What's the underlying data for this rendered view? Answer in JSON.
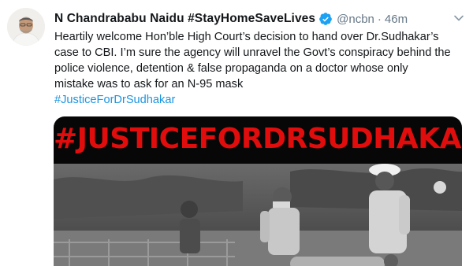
{
  "tweet": {
    "author_name": "N Chandrababu Naidu #StayHomeSaveLives",
    "handle": "@ncbn",
    "separator": "·",
    "timestamp": "46m",
    "text_lines": [
      "Heartily welcome Hon’ble High Court’s decision to hand over Dr.Sudhakar’s",
      "case to CBI. I’m sure the agency will unravel the Govt’s conspiracy behind the",
      "police violence, detention & false propaganda on a doctor whose only",
      "mistake was to ask for an N-95 mask"
    ],
    "hashtag": "#JusticeForDrSudhakar",
    "image_banner_text": "#JUSTICEFORDRSUDHAKAR"
  },
  "icons": {
    "verified": "verified-badge-icon",
    "more": "chevron-down-icon"
  },
  "colors": {
    "link": "#1b95e0",
    "verified": "#1da1f2",
    "muted": "#657786",
    "banner_text": "#e10d0d"
  }
}
